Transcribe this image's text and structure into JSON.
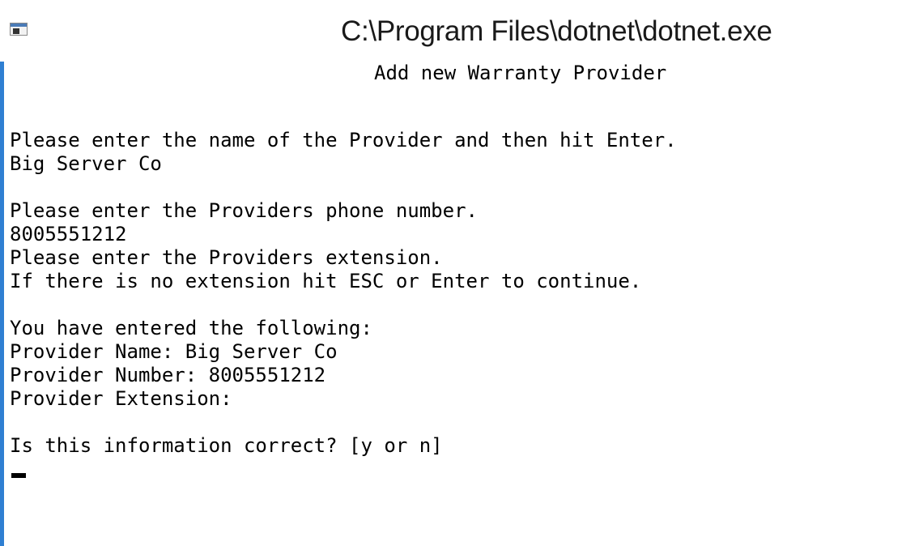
{
  "window": {
    "title": "C:\\Program Files\\dotnet\\dotnet.exe",
    "icon": "console-app-icon"
  },
  "console": {
    "heading": "Add new Warranty Provider",
    "lines": [
      "Please enter the name of the Provider and then hit Enter.",
      "Big Server Co",
      "Please enter the Providers phone number.",
      "8005551212",
      "Please enter the Providers extension.",
      "If there is no extension hit ESC or Enter to continue.",
      "You have entered the following:",
      "Provider Name: Big Server Co",
      "Provider Number: 8005551212",
      "Provider Extension:",
      "Is this information correct? [y or n]"
    ]
  },
  "colors": {
    "background": "#ffffff",
    "text": "#000000",
    "border_accent": "#2f7fd2"
  }
}
